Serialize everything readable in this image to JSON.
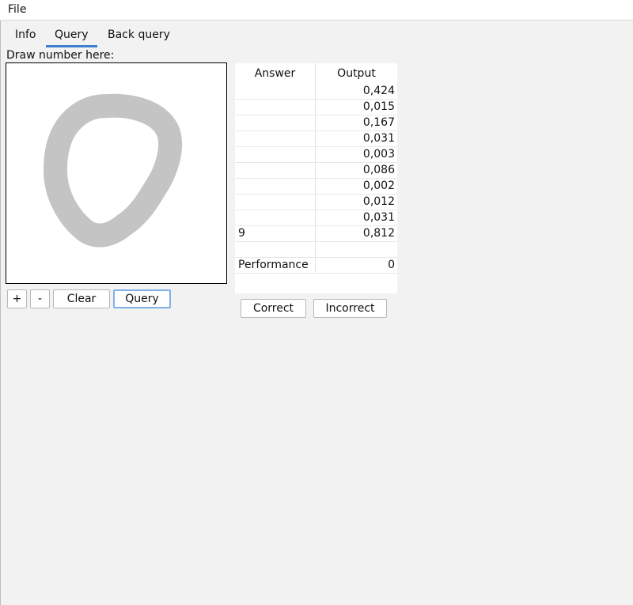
{
  "menubar": {
    "file": "File"
  },
  "tabs": [
    {
      "label": "Info",
      "active": false
    },
    {
      "label": "Query",
      "active": true
    },
    {
      "label": "Back query",
      "active": false
    }
  ],
  "canvas": {
    "label": "Draw number here:"
  },
  "controls": {
    "plus": "+",
    "minus": "-",
    "clear": "Clear",
    "query": "Query"
  },
  "table": {
    "headers": {
      "answer": "Answer",
      "output": "Output"
    },
    "rows": [
      {
        "answer": "",
        "output": "0,424"
      },
      {
        "answer": "",
        "output": "0,015"
      },
      {
        "answer": "",
        "output": "0,167"
      },
      {
        "answer": "",
        "output": "0,031"
      },
      {
        "answer": "",
        "output": "0,003"
      },
      {
        "answer": "",
        "output": "0,086"
      },
      {
        "answer": "",
        "output": "0,002"
      },
      {
        "answer": "",
        "output": "0,012"
      },
      {
        "answer": "",
        "output": "0,031"
      },
      {
        "answer": "9",
        "output": "0,812"
      },
      {
        "answer": "",
        "output": ""
      },
      {
        "answer": "Performance",
        "output": "0"
      }
    ]
  },
  "feedback": {
    "correct": "Correct",
    "incorrect": "Incorrect"
  },
  "colors": {
    "accent": "#3d7fd0",
    "stroke": "#c4c4c4"
  }
}
